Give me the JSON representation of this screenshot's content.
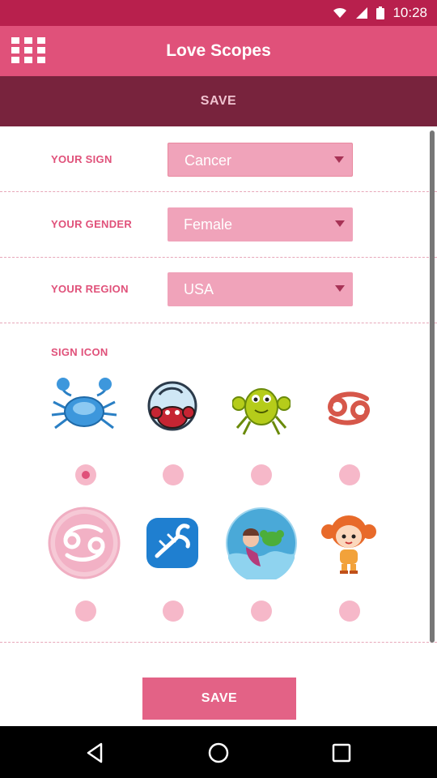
{
  "status_bar": {
    "time": "10:28"
  },
  "app_bar": {
    "title": "Love Scopes"
  },
  "top_save": {
    "label": "SAVE"
  },
  "form": {
    "sign": {
      "label": "YOUR SIGN",
      "value": "Cancer"
    },
    "gender": {
      "label": "YOUR GENDER",
      "value": "Female"
    },
    "region": {
      "label": "YOUR REGION",
      "value": "USA"
    }
  },
  "sign_icon": {
    "label": "SIGN ICON",
    "selected_index": 0,
    "icons": [
      "blue-crab-icon",
      "angry-red-crab-icon",
      "green-crab-icon",
      "cancer-glyph-icon",
      "pink-cancer-glyph-icon",
      "blue-lobster-icon",
      "mermaid-crab-icon",
      "cartoon-girl-crab-icon"
    ]
  },
  "bottom_save": {
    "label": "SAVE"
  },
  "colors": {
    "status_bar": "#b8204d",
    "app_bar": "#e0517a",
    "save_bar": "#78233d",
    "dropdown": "#f0a3ba",
    "accent": "#e0517a"
  },
  "nav": [
    "back-icon",
    "home-icon",
    "recents-icon"
  ]
}
